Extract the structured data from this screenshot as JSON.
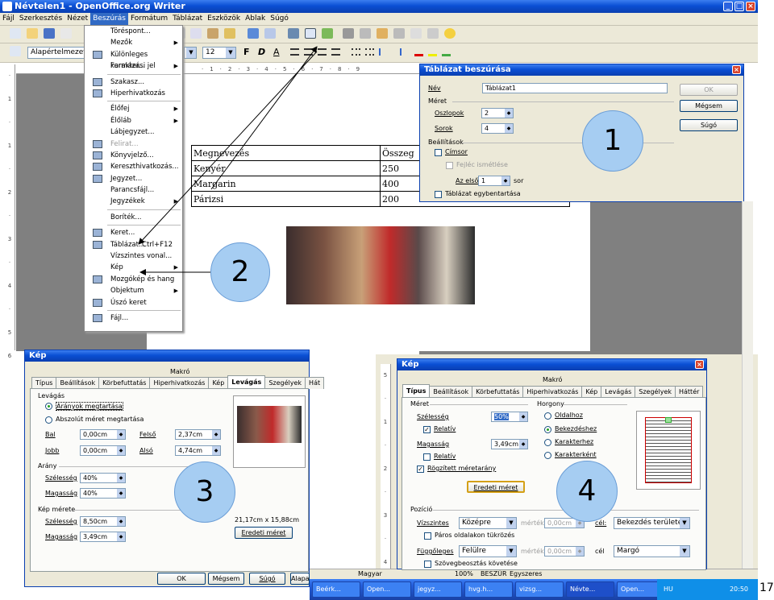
{
  "app": {
    "title": "Névtelen1 - OpenOffice.org Writer",
    "menus": [
      "Fájl",
      "Szerkesztés",
      "Nézet",
      "Beszúrás",
      "Formátum",
      "Táblázat",
      "Eszközök",
      "Ablak",
      "Súgó"
    ],
    "style_value": "Alapértelmezett",
    "font_size": "12",
    "format_buttons": [
      "F",
      "D",
      "A"
    ]
  },
  "insert_menu": {
    "items": [
      {
        "label": "Töréspont...",
        "icon": "",
        "sub": false,
        "accel": "",
        "disabled": false
      },
      {
        "label": "Mezők",
        "icon": "",
        "sub": true,
        "accel": "",
        "disabled": false
      },
      {
        "label": "Különleges karakter...",
        "icon": "special-char-icon",
        "sub": false,
        "accel": "",
        "disabled": false
      },
      {
        "label": "Formázási jel",
        "icon": "",
        "sub": true,
        "accel": "",
        "disabled": false
      },
      {
        "sep": true
      },
      {
        "label": "Szakasz...",
        "icon": "section-icon",
        "sub": false,
        "accel": "",
        "disabled": false
      },
      {
        "label": "Hiperhivatkozás",
        "icon": "hyperlink-icon",
        "sub": false,
        "accel": "",
        "disabled": false
      },
      {
        "sep": true
      },
      {
        "label": "Élőfej",
        "icon": "",
        "sub": true,
        "accel": "",
        "disabled": false
      },
      {
        "label": "Élőláb",
        "icon": "",
        "sub": true,
        "accel": "",
        "disabled": false
      },
      {
        "label": "Lábjegyzet...",
        "icon": "",
        "sub": false,
        "accel": "",
        "disabled": false
      },
      {
        "label": "Felirat...",
        "icon": "caption-icon",
        "sub": false,
        "accel": "",
        "disabled": true
      },
      {
        "label": "Könyvjelző...",
        "icon": "bookmark-icon",
        "sub": false,
        "accel": "",
        "disabled": false
      },
      {
        "label": "Kereszthivatkozás...",
        "icon": "crossref-icon",
        "sub": false,
        "accel": "",
        "disabled": false
      },
      {
        "label": "Jegyzet...",
        "icon": "note-icon",
        "sub": false,
        "accel": "",
        "disabled": false
      },
      {
        "label": "Parancsfájl...",
        "icon": "",
        "sub": false,
        "accel": "",
        "disabled": false
      },
      {
        "label": "Jegyzékek",
        "icon": "",
        "sub": true,
        "accel": "",
        "disabled": false
      },
      {
        "sep": true
      },
      {
        "label": "Boríték...",
        "icon": "",
        "sub": false,
        "accel": "",
        "disabled": false
      },
      {
        "sep": true
      },
      {
        "label": "Keret...",
        "icon": "frame-icon",
        "sub": false,
        "accel": "",
        "disabled": false
      },
      {
        "label": "Táblázat...",
        "icon": "table-icon",
        "sub": false,
        "accel": "Ctrl+F12",
        "disabled": false
      },
      {
        "label": "Vízszintes vonal...",
        "icon": "",
        "sub": false,
        "accel": "",
        "disabled": false
      },
      {
        "label": "Kép",
        "icon": "",
        "sub": true,
        "accel": "",
        "disabled": false
      },
      {
        "label": "Mozgókép és hang",
        "icon": "movie-icon",
        "sub": false,
        "accel": "",
        "disabled": false
      },
      {
        "label": "Objektum",
        "icon": "",
        "sub": true,
        "accel": "",
        "disabled": false
      },
      {
        "label": "Úszó keret",
        "icon": "floating-frame-icon",
        "sub": false,
        "accel": "",
        "disabled": false
      },
      {
        "sep": true
      },
      {
        "label": "Fájl...",
        "icon": "file-icon",
        "sub": false,
        "accel": "",
        "disabled": false
      }
    ]
  },
  "doc_table": {
    "rows": [
      [
        "Megnevezés",
        "Összeg"
      ],
      [
        "Kenyér",
        "250"
      ],
      [
        "Margarin",
        "400"
      ],
      [
        "Párizsi",
        "200"
      ]
    ]
  },
  "table_dialog": {
    "title": "Táblázat beszúrása",
    "name_label": "Név",
    "name_value": "Táblázat1",
    "size_label": "Méret",
    "columns_label": "Oszlopok",
    "columns_value": "2",
    "rows_label": "Sorok",
    "rows_value": "4",
    "settings_label": "Beállítások",
    "heading_label": "Címsor",
    "repeat_heading_label": "Fejléc ismétlése",
    "first_label": "Az első",
    "first_value": "1",
    "rows_suffix": "sor",
    "keep_label": "Táblázat egybentartása",
    "ok": "OK",
    "cancel": "Mégsem",
    "help": "Súgó"
  },
  "crop_dialog": {
    "title": "Kép",
    "group": "Makró",
    "tabs": [
      "Típus",
      "Beállítások",
      "Körbefuttatás",
      "Hiperhivatkozás",
      "Kép",
      "Levágás",
      "Szegélyek",
      "Hát"
    ],
    "active_tab": "Levágás",
    "crop_label": "Levágás",
    "keep_scale": "Arányok megtartása",
    "keep_size": "Abszolút méret megtartása",
    "left_label": "Bal",
    "left_value": "0,00cm",
    "right_label": "Jobb",
    "right_value": "0,00cm",
    "top_label": "Felső",
    "top_value": "2,37cm",
    "bottom_label": "Alsó",
    "bottom_value": "4,74cm",
    "scale_label": "Arány",
    "width_label": "Szélesség",
    "scale_w": "40%",
    "height_label": "Magasság",
    "scale_h": "40%",
    "imgsize_label": "Kép mérete",
    "size_w": "8,50cm",
    "size_h": "3,49cm",
    "orig_size": "21,17cm x 15,88cm",
    "orig_btn": "Eredeti méret",
    "ok": "OK",
    "cancel": "Mégsem",
    "help": "Súgó",
    "reset": "Alapa"
  },
  "type_dialog": {
    "title": "Kép",
    "group": "Makró",
    "tabs": [
      "Típus",
      "Beállítások",
      "Körbefuttatás",
      "Hiperhivatkozás",
      "Kép",
      "Levágás",
      "Szegélyek",
      "Háttér"
    ],
    "active_tab": "Típus",
    "size_label": "Méret",
    "width_label": "Szélesség",
    "width_value": "50%",
    "relative_label": "Relatív",
    "height_label": "Magasság",
    "height_value": "3,49cm",
    "relative2_label": "Relatív",
    "keep_ratio": "Rögzített méretarány",
    "orig_btn": "Eredeti méret",
    "anchor_label": "Horgony",
    "anchor_opts": [
      "Oldalhoz",
      "Bekezdéshez",
      "Karakterhez",
      "Karakterként"
    ],
    "pos_label": "Pozíció",
    "horiz_label": "Vízszintes",
    "horiz_value": "Középre",
    "by_label": "mérték",
    "by_value": "0,00cm",
    "to_label": "cél:",
    "to_value": "Bekezdés területe",
    "mirror_label": "Páros oldalakon tükrözés",
    "vert_label": "Függőleges",
    "vert_value": "Felülre",
    "by2_value": "0,00cm",
    "to2_label": "cél",
    "to2_value": "Margó",
    "follow_label": "Szövegbeosztás követése"
  },
  "status": {
    "lang": "Magyar",
    "zoom": "100%",
    "mode": "BESZÚR",
    "sel": "Egyszeres"
  },
  "taskbar": {
    "items": [
      "Beérk...",
      "Open...",
      "jegyz...",
      "hvg.h...",
      "vizsg...",
      "Névte...",
      "Open..."
    ],
    "active_index": 5,
    "lang": "HU",
    "clock": "20:50"
  },
  "callouts": [
    "1",
    "2",
    "3",
    "4"
  ],
  "page_number": "17"
}
